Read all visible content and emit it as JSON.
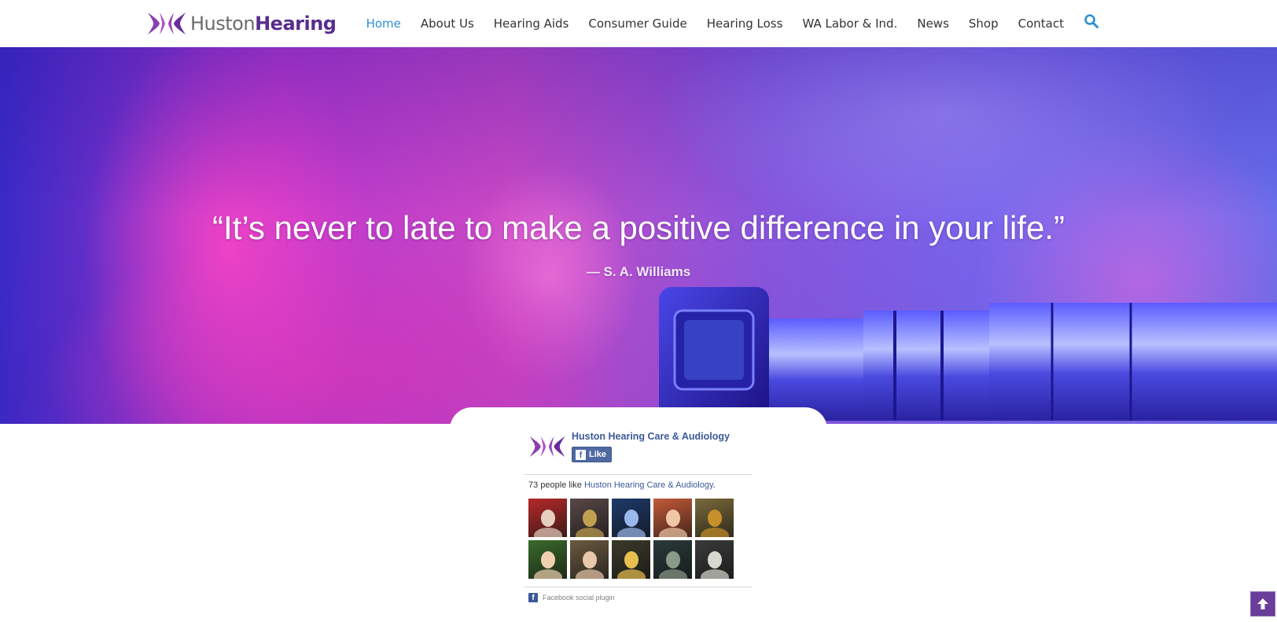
{
  "brand": {
    "name_light": "Huston",
    "name_bold": "Hearing",
    "color_light": "#6b6b6b",
    "color_bold": "#5a2d8e"
  },
  "nav": {
    "items": [
      {
        "label": "Home",
        "active": true
      },
      {
        "label": "About Us"
      },
      {
        "label": "Hearing Aids"
      },
      {
        "label": "Consumer Guide"
      },
      {
        "label": "Hearing Loss"
      },
      {
        "label": "WA Labor & Ind."
      },
      {
        "label": "News"
      },
      {
        "label": "Shop"
      },
      {
        "label": "Contact"
      }
    ],
    "active_color": "#2e8ed6",
    "search_icon": "search-icon"
  },
  "hero": {
    "quote": "“It’s never to late to make a positive difference in your life.”",
    "author": "— S. A. Williams"
  },
  "facebook": {
    "page_name": "Huston Hearing Care & Audiology",
    "like_label": "Like",
    "count_prefix": "73 people like ",
    "count_link": "Huston Hearing Care & Audiology",
    "count_suffix": ".",
    "footer": "Facebook social plugin",
    "brand_color": "#3b5998",
    "faces": [
      {
        "name": "fan-photo-1",
        "bg": "#b52a2a",
        "accent": "#e6d0c0"
      },
      {
        "name": "fan-photo-2",
        "bg": "#5a4848",
        "accent": "#c0a050"
      },
      {
        "name": "fan-photo-3",
        "bg": "#1e3a6a",
        "accent": "#9ab8ea"
      },
      {
        "name": "fan-photo-4",
        "bg": "#c55a3a",
        "accent": "#f0c8a8"
      },
      {
        "name": "fan-photo-5",
        "bg": "#7a6a3a",
        "accent": "#c8902a"
      },
      {
        "name": "fan-photo-6",
        "bg": "#3a6a2a",
        "accent": "#f0d0b0"
      },
      {
        "name": "fan-photo-7",
        "bg": "#6a5a40",
        "accent": "#e8c8a8"
      },
      {
        "name": "fan-photo-8",
        "bg": "#3a3a2a",
        "accent": "#e8c050"
      },
      {
        "name": "fan-photo-9",
        "bg": "#2a3a3a",
        "accent": "#8a9a8a"
      },
      {
        "name": "fan-photo-10",
        "bg": "#3a3a3a",
        "accent": "#d8d8d0"
      }
    ]
  },
  "back_to_top": {
    "icon": "arrow-up-icon",
    "color": "#6a3d9a"
  }
}
